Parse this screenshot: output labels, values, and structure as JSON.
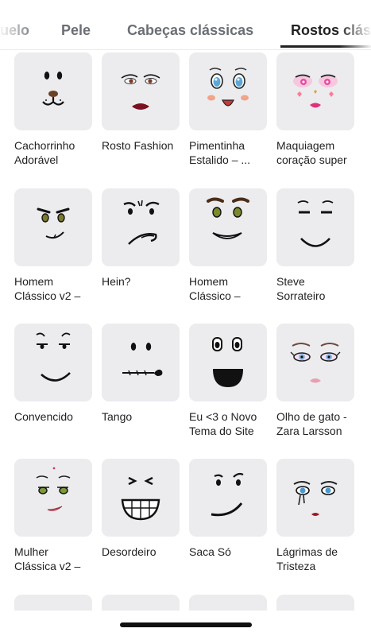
{
  "tabs": [
    {
      "label": "uelo",
      "active": false
    },
    {
      "label": "Pele",
      "active": false
    },
    {
      "label": "Cabeças clássicas",
      "active": false
    },
    {
      "label": "Rostos clás",
      "active": true
    }
  ],
  "faces": [
    {
      "name_line1": "Cachorrinho",
      "name_line2": "Adorável",
      "icon": "puppy-face-icon"
    },
    {
      "name_line1": "Rosto Fashion",
      "name_line2": "",
      "icon": "fashion-face-icon"
    },
    {
      "name_line1": "Pimentinha",
      "name_line2": "Estalido – ...",
      "icon": "pimentinha-face-icon"
    },
    {
      "name_line1": "Maquiagem",
      "name_line2": "coração super",
      "icon": "heart-makeup-face-icon"
    },
    {
      "name_line1": "Homem",
      "name_line2": "Clássico v2 –",
      "icon": "classic-man-v2-face-icon"
    },
    {
      "name_line1": "Hein?",
      "name_line2": "",
      "icon": "hein-face-icon"
    },
    {
      "name_line1": "Homem",
      "name_line2": "Clássico –",
      "icon": "classic-man-face-icon"
    },
    {
      "name_line1": "Steve",
      "name_line2": "Sorrateiro",
      "icon": "sneaky-steve-face-icon"
    },
    {
      "name_line1": "Convencido",
      "name_line2": "",
      "icon": "smug-face-icon"
    },
    {
      "name_line1": "Tango",
      "name_line2": "",
      "icon": "tango-rose-face-icon"
    },
    {
      "name_line1": "Eu <3 o Novo",
      "name_line2": "Tema do Site",
      "icon": "site-theme-face-icon"
    },
    {
      "name_line1": "Olho de gato -",
      "name_line2": "Zara Larsson",
      "icon": "cat-eye-face-icon"
    },
    {
      "name_line1": "Mulher",
      "name_line2": "Clássica v2 –",
      "icon": "classic-woman-v2-face-icon"
    },
    {
      "name_line1": "Desordeiro",
      "name_line2": "",
      "icon": "troublemaker-face-icon"
    },
    {
      "name_line1": "Saca Só",
      "name_line2": "",
      "icon": "check-it-face-icon"
    },
    {
      "name_line1": "Lágrimas de",
      "name_line2": "Tristeza",
      "icon": "sad-tears-face-icon"
    }
  ],
  "colors": {
    "tile_bg": "#ececef",
    "active_tab": "#222222",
    "inactive_tab": "#6b6f75"
  }
}
